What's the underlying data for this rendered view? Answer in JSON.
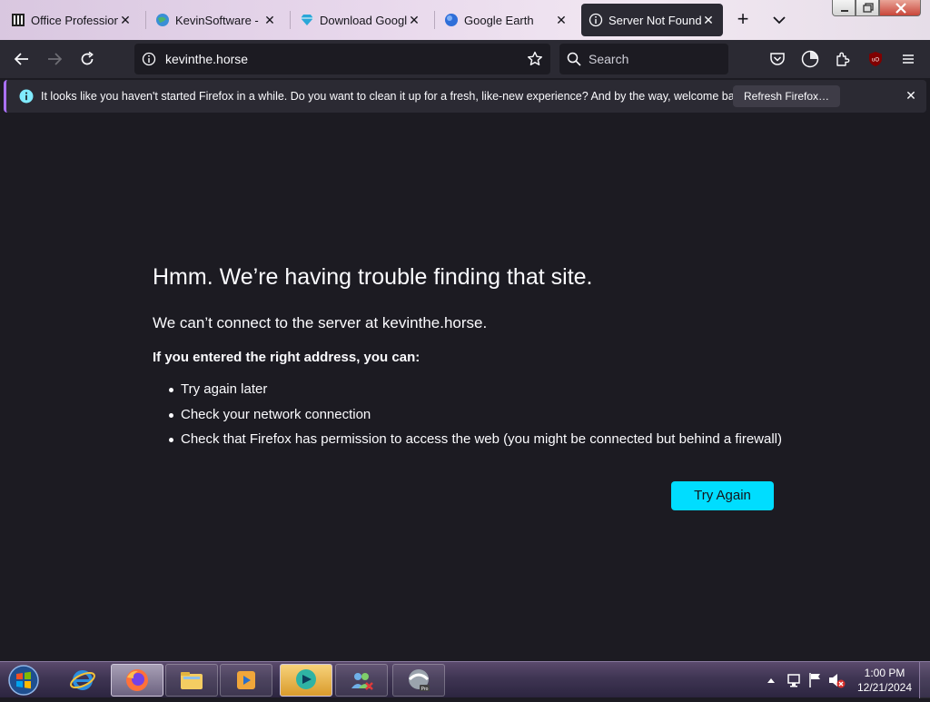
{
  "tabs": [
    {
      "title": "Office Professional",
      "selected": false
    },
    {
      "title": "KevinSoftware - File",
      "selected": false
    },
    {
      "title": "Download Google",
      "selected": false
    },
    {
      "title": "Google Earth",
      "selected": false
    },
    {
      "title": "Server Not Found",
      "selected": true
    }
  ],
  "navbar": {
    "url": "kevinthe.horse",
    "search_placeholder": "Search"
  },
  "notification": {
    "message": "It looks like you haven't started Firefox in a while. Do you want to clean it up for a fresh, like-new experience? And by the way, welcome back!",
    "button_label": "Refresh Firefox…",
    "close_glyph": "✕"
  },
  "error": {
    "title": "Hmm. We’re having trouble finding that site.",
    "subtitle": "We can’t connect to the server at kevinthe.horse.",
    "hint": "If you entered the right address, you can:",
    "suggestions": [
      "Try again later",
      "Check your network connection",
      "Check that Firefox has permission to access the web (you might be connected but behind a firewall)"
    ],
    "try_again_label": "Try Again"
  },
  "taskbar": {
    "items": [
      "internet-explorer",
      "firefox",
      "file-explorer",
      "media-player",
      "app-chat",
      "app-people",
      "google-earth-pro"
    ],
    "clock_time": "1:00 PM",
    "clock_date": "12/21/2024"
  },
  "colors": {
    "accent_button": "#00ddff",
    "page_bg": "#1c1b22",
    "toolbar_bg": "#2b2a33"
  }
}
